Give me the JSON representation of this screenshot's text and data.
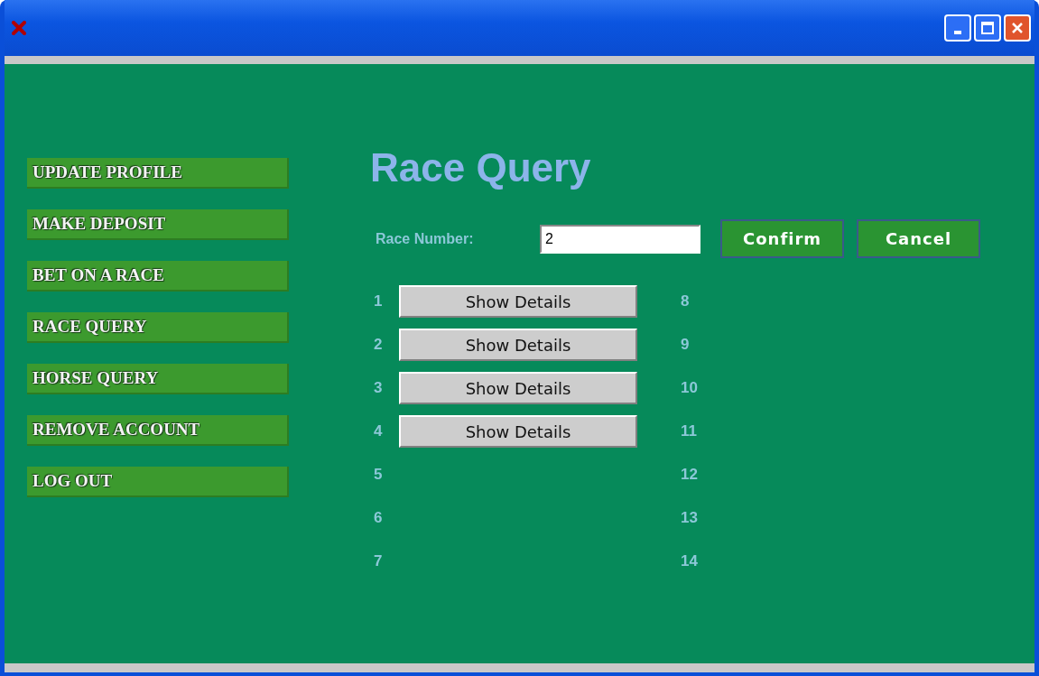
{
  "menu": [
    {
      "label": "UPDATE PROFILE"
    },
    {
      "label": "MAKE DEPOSIT"
    },
    {
      "label": "BET ON A RACE"
    },
    {
      "label": "RACE QUERY"
    },
    {
      "label": "HORSE QUERY"
    },
    {
      "label": "REMOVE ACCOUNT"
    },
    {
      "label": "LOG OUT"
    }
  ],
  "title": "Race Query",
  "race_number": {
    "label": "Race Number:",
    "value": "2"
  },
  "buttons": [
    "Confirm",
    "Cancel"
  ],
  "slots_left": [
    {
      "number": "1",
      "button": "Show Details"
    },
    {
      "number": "2",
      "button": "Show Details"
    },
    {
      "number": "3",
      "button": "Show Details"
    },
    {
      "number": "4",
      "button": "Show Details"
    },
    {
      "number": "5"
    },
    {
      "number": "6"
    },
    {
      "number": "7"
    }
  ],
  "slots_right": [
    {
      "number": "8"
    },
    {
      "number": "9"
    },
    {
      "number": "10"
    },
    {
      "number": "11"
    },
    {
      "number": "12"
    },
    {
      "number": "13"
    },
    {
      "number": "14"
    }
  ]
}
